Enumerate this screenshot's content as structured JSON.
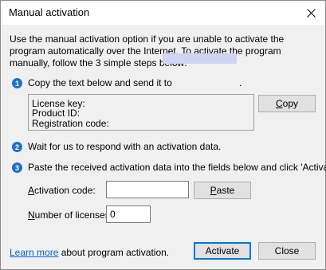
{
  "window": {
    "title": "Manual activation",
    "close_glyph": "✕"
  },
  "intro_text": "Use the manual activation option if you are unable to activate the program automatically over the Internet. To activate the program manually, follow the 3 simple steps below:",
  "steps": [
    {
      "number": "1",
      "text": "Copy the text below and send it to",
      "suffix": "."
    },
    {
      "number": "2",
      "text": "Wait for us to respond with an activation data."
    },
    {
      "number": "3",
      "text": "Paste the received activation data into the fields below and click 'Activate'."
    }
  ],
  "license_info": {
    "key_label": "License key:",
    "product_label": "Product ID:",
    "registration_label": "Registration code:"
  },
  "buttons": {
    "copy_prefix": "C",
    "copy_rest": "opy",
    "paste_prefix": "P",
    "paste_rest": "aste",
    "activate": "Activate",
    "close": "Close"
  },
  "fields": {
    "activation_code_prefix": "A",
    "activation_code_rest": "ctivation code:",
    "activation_code_value": "",
    "licenses_prefix": "N",
    "licenses_rest": "umber of licenses:",
    "licenses_value": "0"
  },
  "footer": {
    "learn_more": "Learn more",
    "rest": " about program activation."
  },
  "colors": {
    "step_icon": "#1e6fce",
    "link": "#0066cc",
    "email_redacted": "#cfd5f2"
  },
  "icons": [
    "close-icon",
    "step-1-icon",
    "step-2-icon",
    "step-3-icon"
  ]
}
